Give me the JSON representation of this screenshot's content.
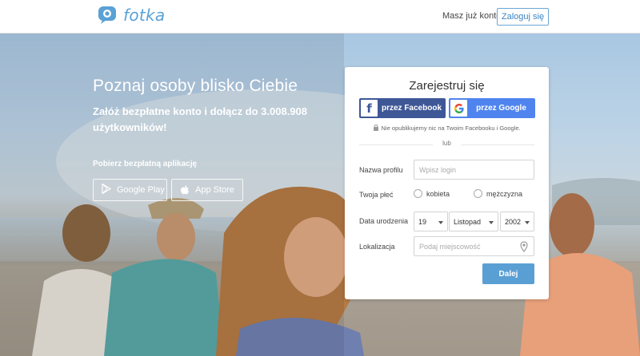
{
  "header": {
    "logo_text": "fotka",
    "have_account": "Masz już konto?",
    "login_label": "Zaloguj się"
  },
  "hero": {
    "title": "Poznaj osoby blisko Ciebie",
    "subtitle": "Załóż bezpłatne konto i dołącz do 3.008.908 użytkowników!",
    "app_label": "Pobierz bezpłatną aplikację",
    "google_play_label": "Google Play",
    "app_store_label": "App Store"
  },
  "register": {
    "title": "Zarejestruj się",
    "facebook_label": "przez Facebook",
    "google_label": "przez Google",
    "privacy_note": "Nie opublikujemy nic na Twoim Facebooku i Google.",
    "or_label": "lub",
    "profile_label": "Nazwa profilu",
    "profile_placeholder": "Wpisz login",
    "gender_label": "Twoja płeć",
    "gender_female": "kobieta",
    "gender_male": "mężczyzna",
    "birth_label": "Data urodzenia",
    "birth_day": "19",
    "birth_month": "Listopad",
    "birth_year": "2002",
    "location_label": "Lokalizacja",
    "location_placeholder": "Podaj miejscowość",
    "submit_label": "Dalej"
  },
  "colors": {
    "brand": "#5aa1d6",
    "facebook": "#3e5796",
    "google": "#4f84ee",
    "submit": "#5a9fd4"
  },
  "icons": [
    "fotka-logo-icon",
    "google-play-icon",
    "apple-icon",
    "facebook-icon",
    "google-icon",
    "lock-icon",
    "location-pin-icon"
  ]
}
